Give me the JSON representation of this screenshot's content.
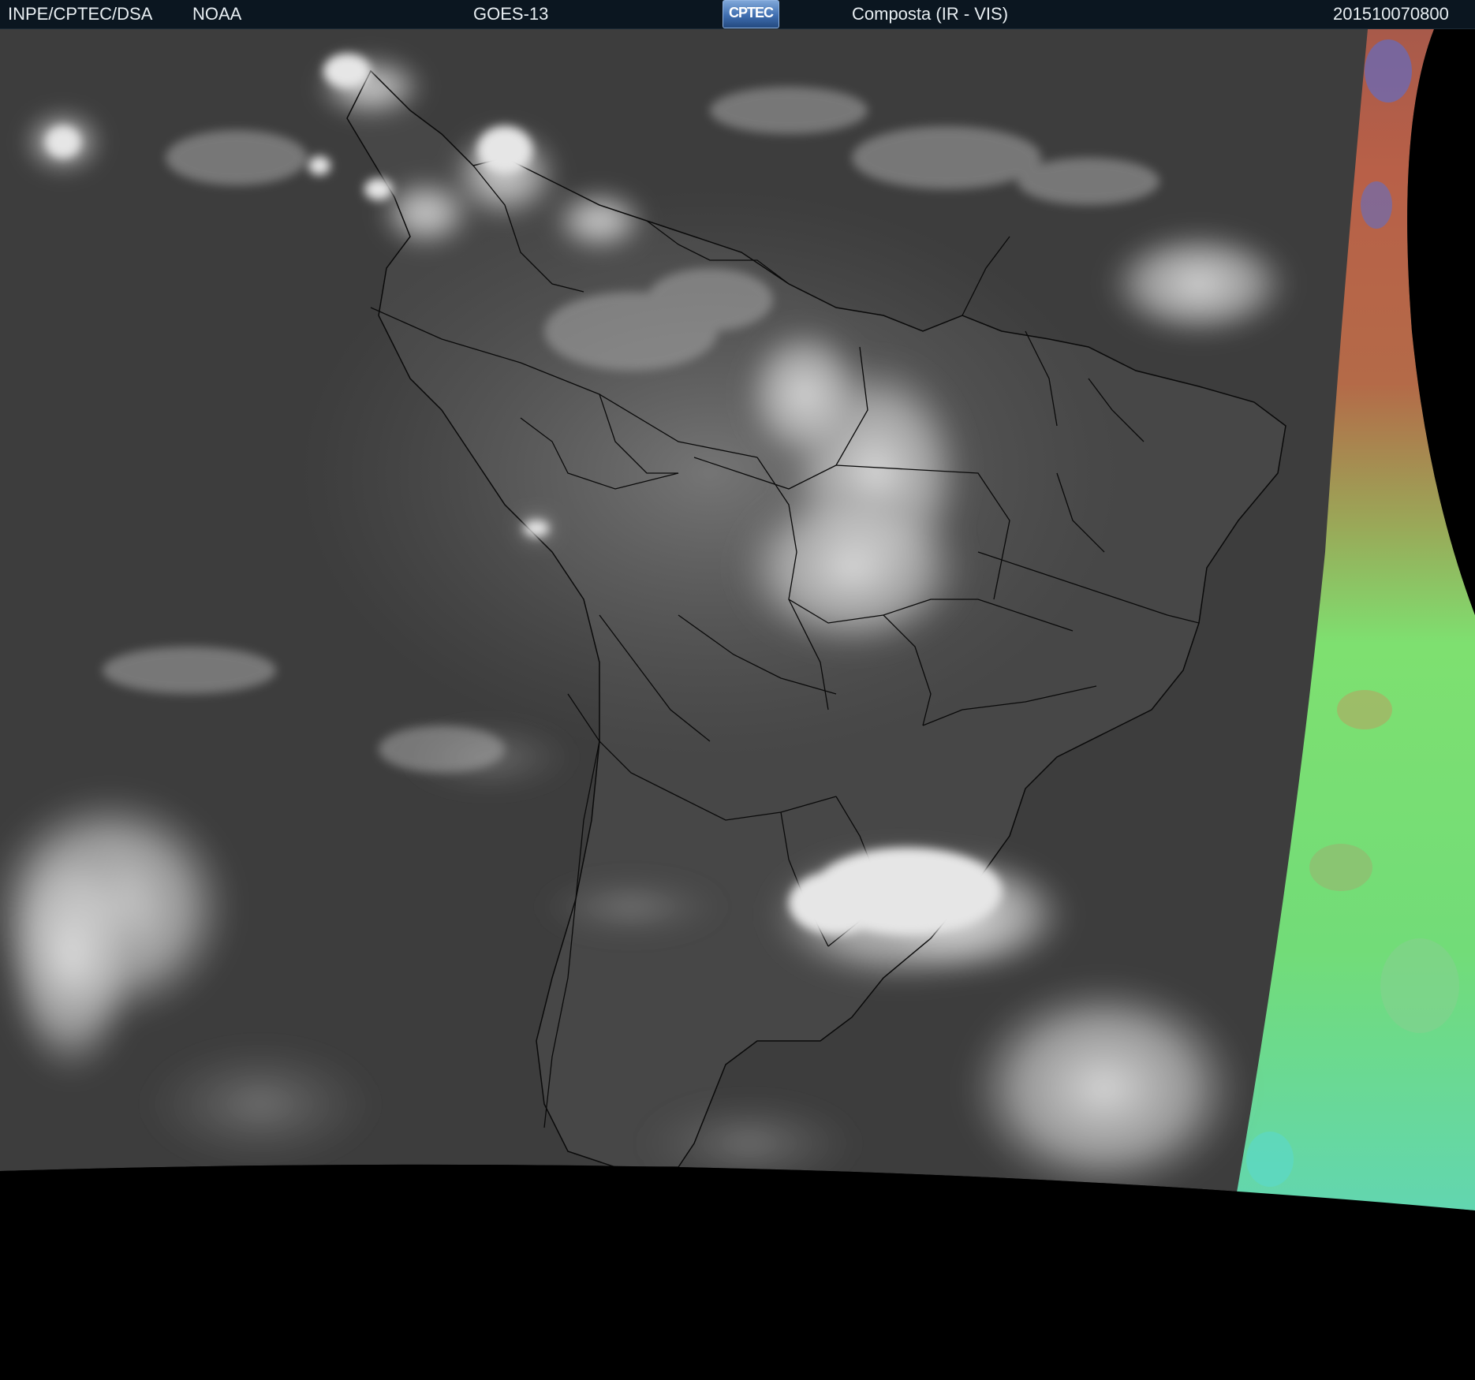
{
  "header": {
    "agency": "INPE/CPTEC/DSA",
    "source": "NOAA",
    "satellite": "GOES-13",
    "logo_text": "CPTEC",
    "product": "Composta (IR - VIS)",
    "timestamp": "201510070800"
  },
  "colors": {
    "background": "#000000",
    "header_bg": "#0b1620",
    "header_text": "#e8eef2",
    "ocean": "#3b3b3b",
    "land": "#4a4a4a",
    "cloud": "#d6d6d6",
    "border_lines": "#000000",
    "ir_red": "#b06048",
    "ir_green": "#7ee070",
    "ir_cyan": "#5ad8d0",
    "ir_blue": "#5070e0"
  },
  "map": {
    "region": "South America",
    "icons": [
      "satellite-image",
      "political-borders",
      "cloud-cover"
    ]
  }
}
